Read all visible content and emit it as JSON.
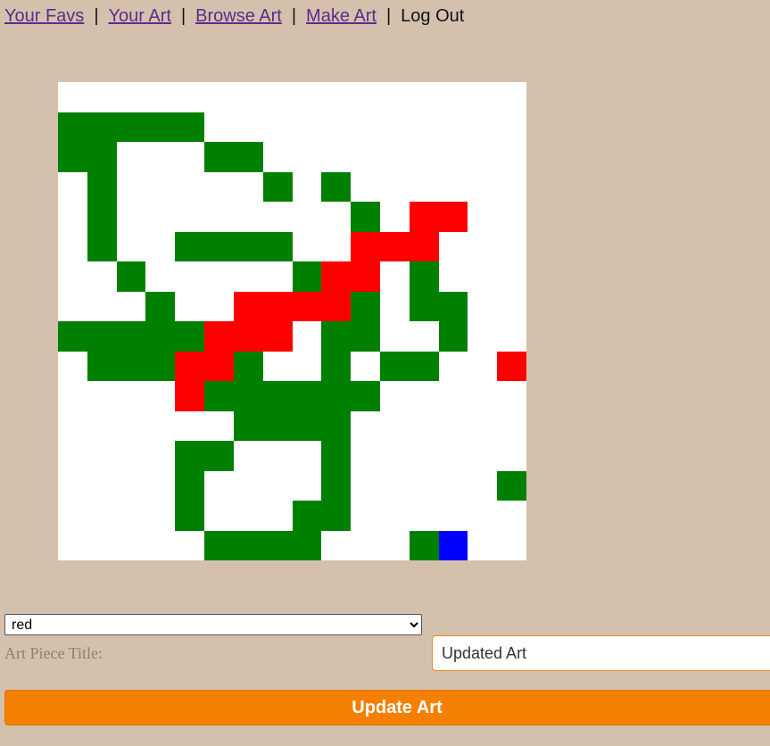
{
  "nav": {
    "your_favs": "Your Favs",
    "your_art": "Your Art",
    "browse_art": "Browse Art",
    "make_art": "Make Art",
    "log_out": "Log Out",
    "separator": "|"
  },
  "colors": {
    "W": "#ffffff",
    "G": "#008000",
    "R": "#ff0000",
    "B": "#0000ff",
    "background": "#d4c1ad",
    "button": "#f57f00",
    "link": "#5b2c8c"
  },
  "pixel_grid": [
    "WWWWWWWWWWWWWWWW",
    "GGGGGWWWWWWWWWWW",
    "GGWWWGGWWWWWWWWW",
    "WGWWWWWGWGWWWWWW",
    "WGWWWWWWWWGWRRWW",
    "WGWWGGGGWWRRRWWW",
    "WWGWWWWWGRRWGWWW",
    "WWWGWWRRRRGWGGWW",
    "GGGGGRRRWGGWWGWW",
    "WGGGRRGWWGWGGWWR",
    "WWWWRGGGGGGWWWWW",
    "WWWWWWGGGGWWWWWW",
    "WWWWGGWWWGWWWWWW",
    "WWWWGWWWWGWWWWWG",
    "WWWWGWWWGGWWWWWW",
    "WWWWWGGGGWWWGBWW"
  ],
  "color_select": {
    "selected": "red"
  },
  "form": {
    "title_label": "Art Piece Title:",
    "title_value": "Updated Art",
    "update_button": "Update Art"
  }
}
